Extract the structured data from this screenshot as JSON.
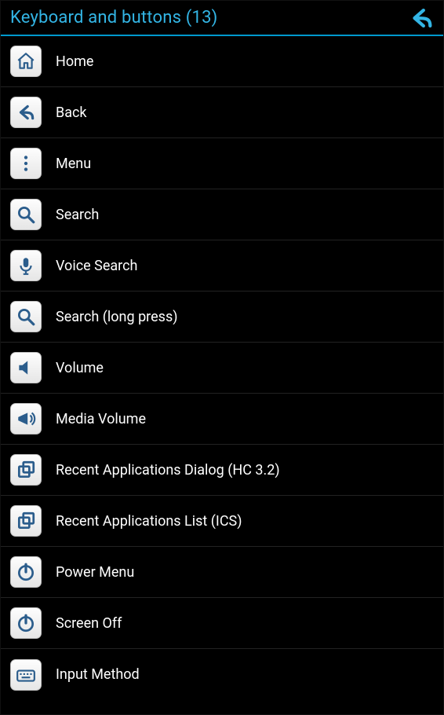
{
  "header": {
    "title": "Keyboard and buttons (13)"
  },
  "items": [
    {
      "label": "Home",
      "icon": "home-icon"
    },
    {
      "label": "Back",
      "icon": "back-arrow-icon"
    },
    {
      "label": "Menu",
      "icon": "menu-dots-icon"
    },
    {
      "label": "Search",
      "icon": "search-icon"
    },
    {
      "label": "Voice Search",
      "icon": "microphone-icon"
    },
    {
      "label": "Search (long press)",
      "icon": "search-icon"
    },
    {
      "label": "Volume",
      "icon": "speaker-icon"
    },
    {
      "label": "Media Volume",
      "icon": "megaphone-icon"
    },
    {
      "label": "Recent Applications Dialog (HC 3.2)",
      "icon": "recent-apps-icon"
    },
    {
      "label": "Recent Applications List (ICS)",
      "icon": "recent-apps-icon"
    },
    {
      "label": "Power Menu",
      "icon": "power-icon"
    },
    {
      "label": "Screen Off",
      "icon": "power-icon"
    },
    {
      "label": "Input Method",
      "icon": "keyboard-icon"
    }
  ]
}
